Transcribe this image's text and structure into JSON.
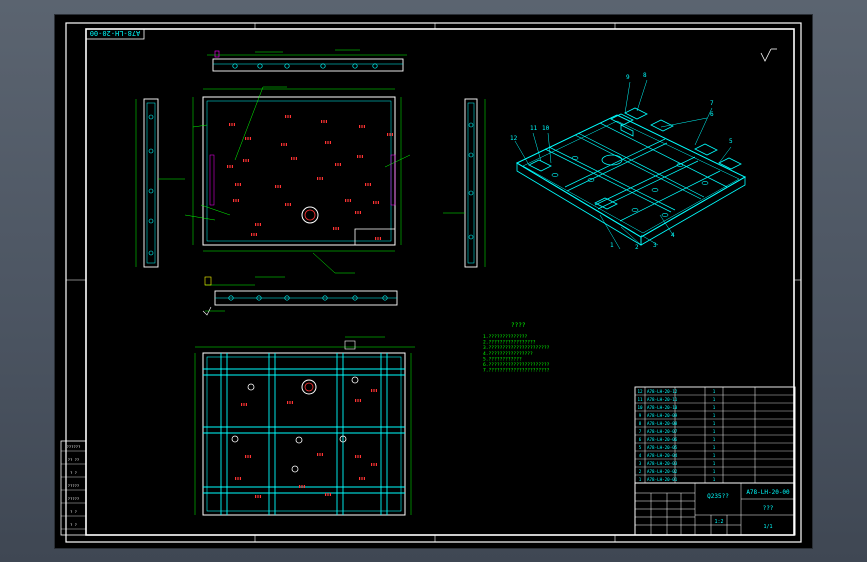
{
  "drawing": {
    "number_upside": "A78-LH-20-00",
    "notes_title": "????",
    "notes": [
      "1.??????????????",
      "2.?????????????????",
      "3.??????????????????????",
      "4.????????????????",
      "5.????????????",
      "6.??????????????????????",
      "7.??????????????????????"
    ],
    "callouts": [
      "1",
      "2",
      "3",
      "4",
      "5",
      "6",
      "7",
      "8",
      "9",
      "10",
      "11",
      "12"
    ],
    "parts_rows": [
      {
        "no": "12",
        "code": "A78-LH-20-12",
        "qty": "1"
      },
      {
        "no": "11",
        "code": "A78-LH-20-11",
        "qty": "1"
      },
      {
        "no": "10",
        "code": "A78-LH-20-10",
        "qty": "1"
      },
      {
        "no": "9",
        "code": "A78-LH-20-09",
        "qty": "1"
      },
      {
        "no": "8",
        "code": "A78-LH-20-08",
        "qty": "1"
      },
      {
        "no": "7",
        "code": "A78-LH-20-07",
        "qty": "1"
      },
      {
        "no": "6",
        "code": "A78-LH-20-06",
        "qty": "1"
      },
      {
        "no": "5",
        "code": "A78-LH-20-05",
        "qty": "1"
      },
      {
        "no": "4",
        "code": "A78-LH-20-04",
        "qty": "1"
      },
      {
        "no": "3",
        "code": "A78-LH-20-03",
        "qty": "1"
      },
      {
        "no": "2",
        "code": "A78-LH-20-02",
        "qty": "1"
      },
      {
        "no": "1",
        "code": "A78-LH-20-01",
        "qty": "1"
      }
    ],
    "title_code": "A78-LH-20-00",
    "title_name": "???",
    "title_company": "Q235??",
    "title_scale": "1:2",
    "title_sheet": "1/1",
    "left_block_lines": [
      "??????",
      "?? ??",
      "? ?",
      "?????",
      "?????",
      "? ?",
      "? ?"
    ],
    "colors": {
      "background": "#000000",
      "frame": "#ffffff",
      "geometry": "#00ffff",
      "annotation": "#00ff00",
      "holes": "#ff3333",
      "detail": "#ff00ff",
      "yellow": "#ffff00"
    }
  }
}
